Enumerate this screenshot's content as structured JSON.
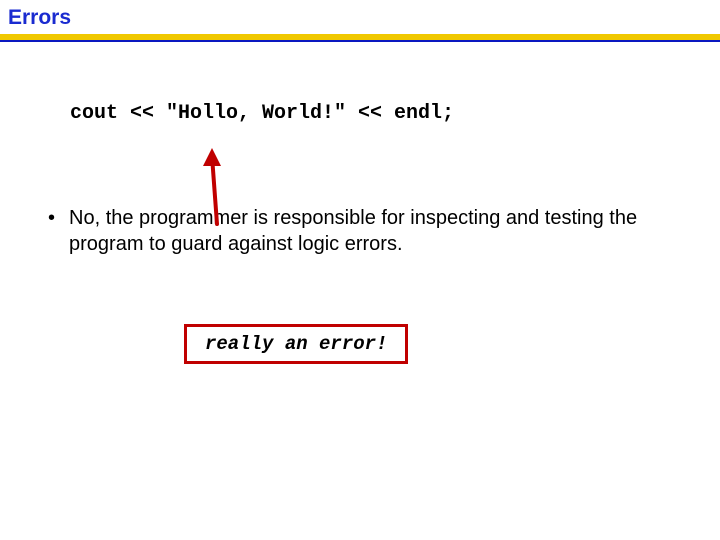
{
  "title": "Errors",
  "code": "cout << \"Hollo, World!\" << endl;",
  "bullet_text": "No, the programmer is responsible for inspecting and testing the program to guard against logic errors.",
  "callout": "really an error!",
  "accent_colors": {
    "title": "#1a2bd0",
    "gold": "#f0c800",
    "blue_line": "#0a18c0",
    "arrow": "#c00000",
    "callout_border": "#c00000"
  }
}
